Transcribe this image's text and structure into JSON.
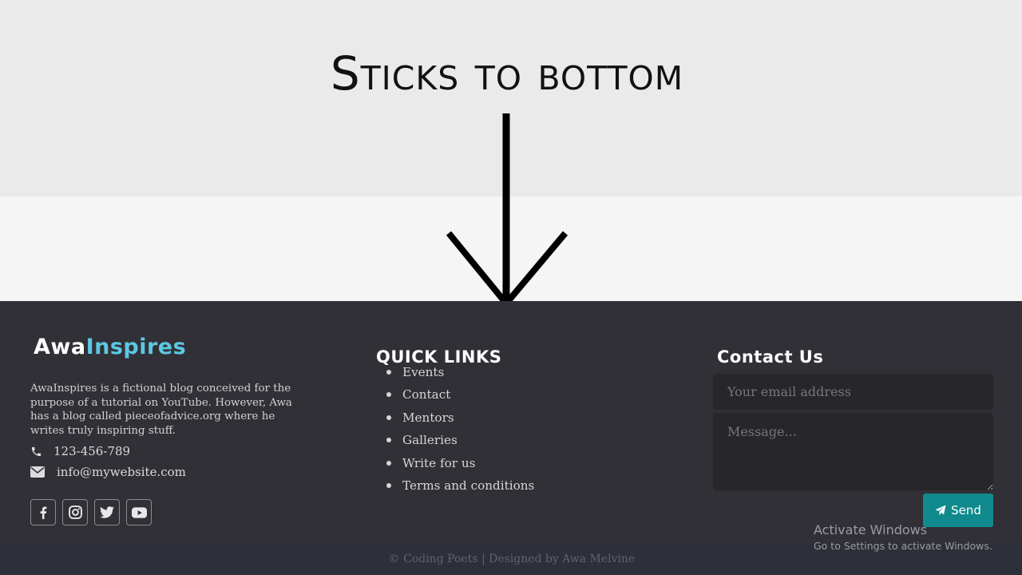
{
  "annotation": {
    "title": "Sticks to bottom",
    "arrow_icon": "down-arrow-icon"
  },
  "brand": {
    "part1": "Awa",
    "part2": "Inspires",
    "accent_color": "#5cc8e2"
  },
  "about": {
    "text": "AwaInspires is a fictional blog conceived for the purpose of a tutorial on YouTube. However, Awa has a blog called pieceofadvice.org where he writes truly inspiring stuff."
  },
  "contact_info": {
    "phone": "123-456-789",
    "phone_icon": "phone-icon",
    "email": "info@mywebsite.com",
    "email_icon": "envelope-icon"
  },
  "socials": [
    {
      "name": "facebook",
      "icon": "facebook-icon"
    },
    {
      "name": "instagram",
      "icon": "instagram-icon"
    },
    {
      "name": "twitter",
      "icon": "twitter-icon"
    },
    {
      "name": "youtube",
      "icon": "youtube-icon"
    }
  ],
  "quick_links": {
    "heading": "QUICK LINKS",
    "items": [
      "Events",
      "Contact",
      "Mentors",
      "Galleries",
      "Write for us",
      "Terms and conditions"
    ]
  },
  "contact_form": {
    "heading": "Contact Us",
    "email_placeholder": "Your email address",
    "email_value": "",
    "message_placeholder": "Message...",
    "message_value": "",
    "send_label": "Send",
    "send_icon": "paper-plane-icon",
    "button_color": "#108a8c"
  },
  "copyright": "© Coding Poets | Designed by Awa Melvine",
  "watermark": {
    "line1": "Activate Windows",
    "line2": "Go to Settings to activate Windows."
  },
  "colors": {
    "footer_bg": "#313036",
    "bottom_bar_bg": "#2d3038",
    "top_band_bg": "#eaeaea",
    "mid_band_bg": "#f5f5f5"
  }
}
